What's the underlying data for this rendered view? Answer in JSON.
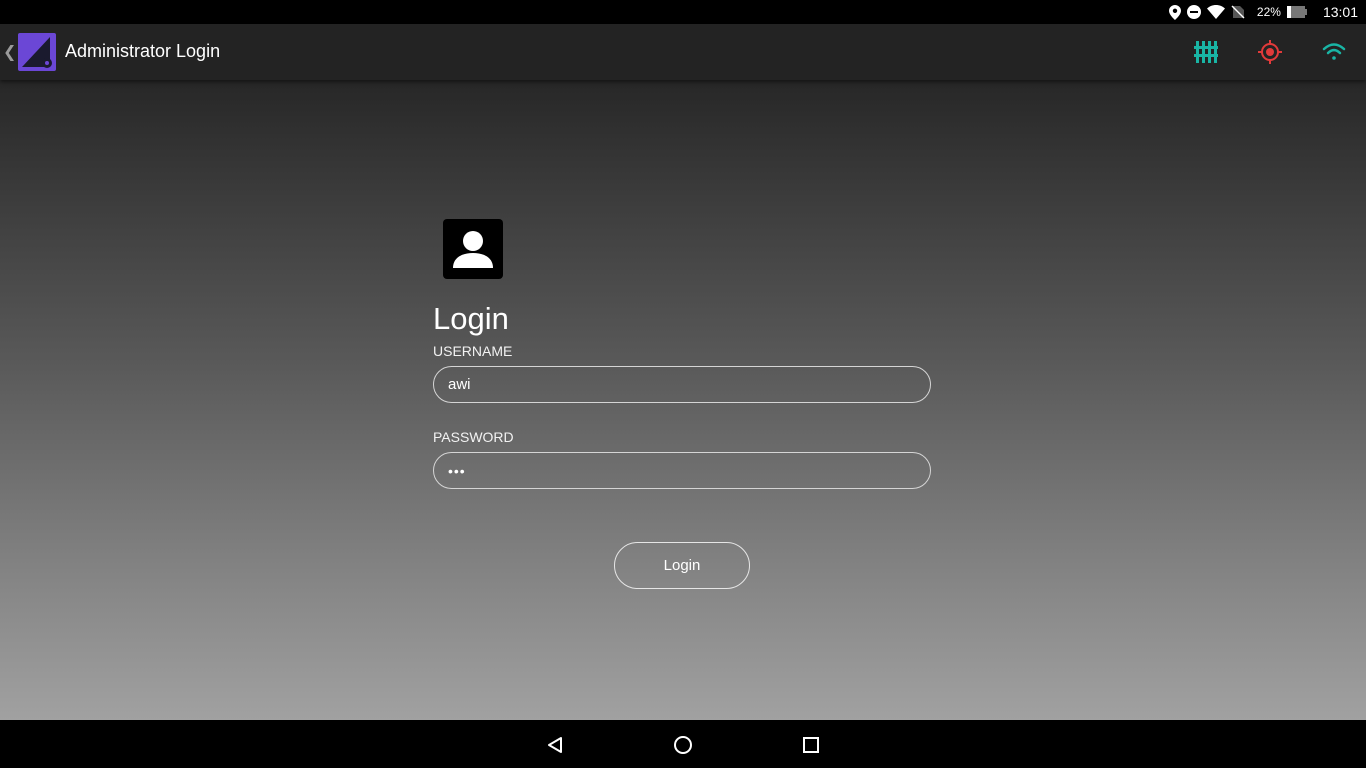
{
  "status_bar": {
    "battery_percent": "22%",
    "time": "13:01",
    "icons": [
      "location-icon",
      "do-not-disturb-icon",
      "wifi-icon",
      "no-sim-icon",
      "battery-icon"
    ]
  },
  "app_bar": {
    "back_glyph": "❮",
    "title": "Administrator Login",
    "icons": [
      "equalizer-icon",
      "target-icon",
      "wifi-icon"
    ],
    "colors": {
      "equalizer": "#19b5a5",
      "target": "#e23a3a",
      "wifi": "#19b5a5",
      "logo_bg": "#6b47d6"
    }
  },
  "form": {
    "title": "Login",
    "username_label": "USERNAME",
    "username_value": "awi",
    "password_label": "PASSWORD",
    "password_masked": "•••",
    "login_button": "Login"
  },
  "nav_bar": {
    "icons": [
      "nav-back-icon",
      "nav-home-icon",
      "nav-recents-icon"
    ]
  }
}
